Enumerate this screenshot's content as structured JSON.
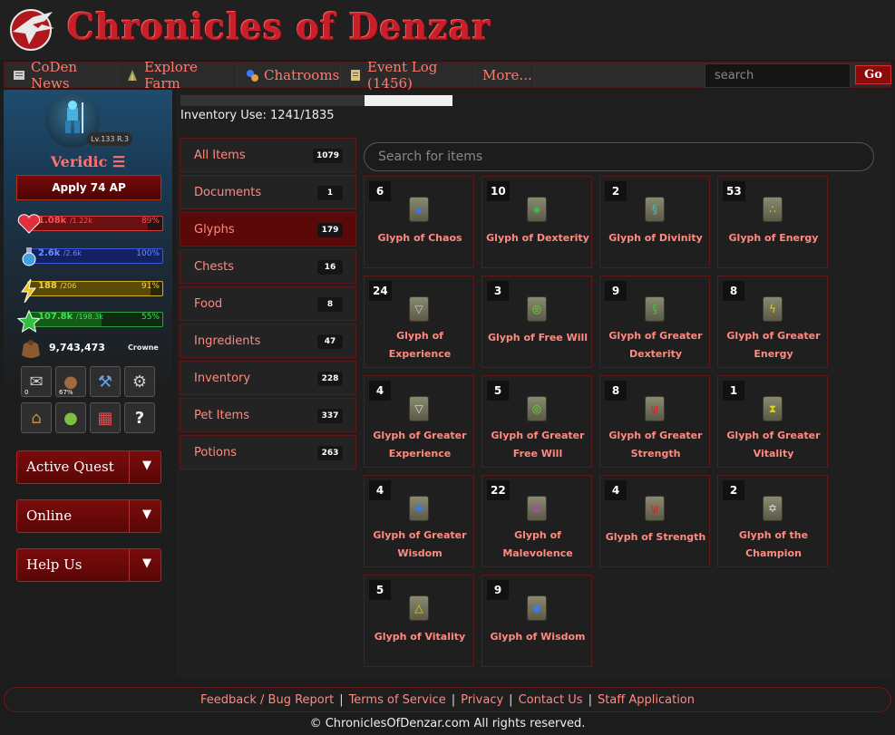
{
  "header": {
    "site_title": "Chronicles of Denzar"
  },
  "nav": {
    "items": [
      {
        "label": "CoDen News",
        "icon": "newspaper-icon"
      },
      {
        "label": "Explore Farm",
        "icon": "farm-icon"
      },
      {
        "label": "Chatrooms",
        "icon": "chat-icon"
      },
      {
        "label": "Event Log (1456)",
        "icon": "scroll-icon"
      },
      {
        "label": "More..."
      }
    ],
    "search_placeholder": "search",
    "go_label": "Go"
  },
  "sidebar": {
    "level_badge": "Lv.133 R.3",
    "username": "Veridic ☰",
    "apply_label": "Apply 74 AP",
    "stats": [
      {
        "name": "health",
        "value": "1.08k",
        "max": "/1.22k",
        "pct": "89%",
        "fraction": 0.89,
        "color": "#d33a3a"
      },
      {
        "name": "mana",
        "value": "2.6k",
        "max": "/2.6k",
        "pct": "100%",
        "fraction": 1.0,
        "color": "#3b5bd8"
      },
      {
        "name": "energy",
        "value": "188",
        "max": "/206",
        "pct": "91%",
        "fraction": 0.91,
        "color": "#d4b020"
      },
      {
        "name": "experience",
        "value": "107.8k",
        "max": "/198.3k",
        "pct": "55%",
        "fraction": 0.55,
        "color": "#2fa03a"
      }
    ],
    "gold": "9,743,473",
    "crowns": "Crowne",
    "icon_buttons": [
      {
        "name": "mail-icon",
        "badge": "0"
      },
      {
        "name": "backpack-icon",
        "badge": "67%"
      },
      {
        "name": "tools-icon",
        "badge": ""
      },
      {
        "name": "gears-icon",
        "badge": ""
      },
      {
        "name": "bank-icon",
        "badge": ""
      },
      {
        "name": "pet-icon",
        "badge": ""
      },
      {
        "name": "shop-icon",
        "badge": ""
      },
      {
        "name": "help-icon",
        "badge": ""
      }
    ],
    "dropdowns": [
      "Active Quest",
      "Online",
      "Help Us"
    ]
  },
  "inventory": {
    "use_label": "Inventory Use: 1241/1835",
    "use_fraction": 0.676,
    "search_placeholder": "Search for items",
    "categories": [
      {
        "label": "All Items",
        "count": "1079",
        "active": false
      },
      {
        "label": "Documents",
        "count": "1",
        "active": false
      },
      {
        "label": "Glyphs",
        "count": "179",
        "active": true
      },
      {
        "label": "Chests",
        "count": "16",
        "active": false
      },
      {
        "label": "Food",
        "count": "8",
        "active": false
      },
      {
        "label": "Ingredients",
        "count": "47",
        "active": false
      },
      {
        "label": "Inventory",
        "count": "228",
        "active": false
      },
      {
        "label": "Pet Items",
        "count": "337",
        "active": false
      },
      {
        "label": "Potions",
        "count": "263",
        "active": false
      }
    ],
    "items": [
      {
        "qty": "6",
        "name": "Glyph of Chaos",
        "glyph": "๑",
        "color": "#3a7aff"
      },
      {
        "qty": "10",
        "name": "Glyph of Dexterity",
        "glyph": "◈",
        "color": "#3ac050"
      },
      {
        "qty": "2",
        "name": "Glyph of Divinity",
        "glyph": "§",
        "color": "#3ac0c0"
      },
      {
        "qty": "53",
        "name": "Glyph of Energy",
        "glyph": "∴",
        "color": "#e0d020"
      },
      {
        "qty": "24",
        "name": "Glyph of Experience",
        "glyph": "▽",
        "color": "#cfcfcf"
      },
      {
        "qty": "3",
        "name": "Glyph of Free Will",
        "glyph": "◎",
        "color": "#60e020"
      },
      {
        "qty": "9",
        "name": "Glyph of Greater Dexterity",
        "glyph": "§",
        "color": "#40c040"
      },
      {
        "qty": "8",
        "name": "Glyph of Greater Energy",
        "glyph": "ϟ",
        "color": "#e0d020"
      },
      {
        "qty": "4",
        "name": "Glyph of Greater Experience",
        "glyph": "▽",
        "color": "#e0e0e0"
      },
      {
        "qty": "5",
        "name": "Glyph of Greater Free Will",
        "glyph": "◎",
        "color": "#60e020"
      },
      {
        "qty": "8",
        "name": "Glyph of Greater Strength",
        "glyph": "ψ",
        "color": "#e02020"
      },
      {
        "qty": "1",
        "name": "Glyph of Greater Vitality",
        "glyph": "⧗",
        "color": "#e0d020"
      },
      {
        "qty": "4",
        "name": "Glyph of Greater Wisdom",
        "glyph": "❋",
        "color": "#3a7aff"
      },
      {
        "qty": "22",
        "name": "Glyph of Malevolence",
        "glyph": "ὦ",
        "color": "#c040c0"
      },
      {
        "qty": "4",
        "name": "Glyph of Strength",
        "glyph": "ψ",
        "color": "#e02020"
      },
      {
        "qty": "2",
        "name": "Glyph of the Champion",
        "glyph": "✡",
        "color": "#e0e0e0"
      },
      {
        "qty": "5",
        "name": "Glyph of Vitality",
        "glyph": "△",
        "color": "#e0d020"
      },
      {
        "qty": "9",
        "name": "Glyph of Wisdom",
        "glyph": "◆",
        "color": "#3a7aff"
      }
    ]
  },
  "footer": {
    "links": [
      "Feedback / Bug Report",
      "Terms of Service",
      "Privacy",
      "Contact Us",
      "Staff Application"
    ],
    "copyright": "© ChroniclesOfDenzar.com All rights reserved."
  }
}
